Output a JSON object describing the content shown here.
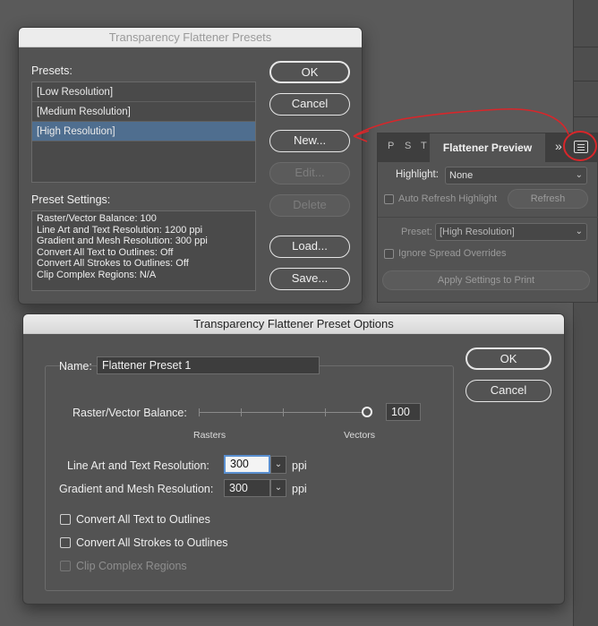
{
  "presets_dialog": {
    "title": "Transparency Flattener Presets",
    "presets_label": "Presets:",
    "presets": [
      "[Low Resolution]",
      "[Medium Resolution]",
      "[High Resolution]"
    ],
    "settings_label": "Preset Settings:",
    "settings_lines": [
      "Raster/Vector Balance: 100",
      "Line Art and Text Resolution: 1200 ppi",
      "Gradient and Mesh Resolution: 300 ppi",
      "Convert All Text to Outlines: Off",
      "Convert All Strokes to Outlines: Off",
      "Clip Complex Regions: N/A"
    ],
    "buttons": {
      "ok": "OK",
      "cancel": "Cancel",
      "new": "New...",
      "edit": "Edit...",
      "delete": "Delete",
      "load": "Load...",
      "save": "Save..."
    }
  },
  "preview_panel": {
    "tabs": [
      "P",
      "S",
      "T"
    ],
    "active_tab": "Flattener Preview",
    "overflow": "»",
    "highlight_label": "Highlight:",
    "highlight_value": "None",
    "auto_refresh_label": "Auto Refresh Highlight",
    "refresh_button": "Refresh",
    "preset_label": "Preset:",
    "preset_value": "[High Resolution]",
    "ignore_spread_label": "Ignore Spread Overrides",
    "apply_button": "Apply Settings to Print",
    "annotation_color": "#d8262a"
  },
  "options_dialog": {
    "title": "Transparency Flattener Preset Options",
    "name_label": "Name:",
    "name_value": "Flattener Preset 1",
    "balance_label": "Raster/Vector Balance:",
    "balance_value": "100",
    "rasters_label": "Rasters",
    "vectors_label": "Vectors",
    "line_art_label": "Line Art and Text Resolution:",
    "line_art_value": "300",
    "gradient_label": "Gradient and Mesh Resolution:",
    "gradient_value": "300",
    "ppi": "ppi",
    "convert_text_label": "Convert All Text to Outlines",
    "convert_strokes_label": "Convert All Strokes to Outlines",
    "clip_complex_label": "Clip Complex Regions",
    "ok": "OK",
    "cancel": "Cancel"
  }
}
